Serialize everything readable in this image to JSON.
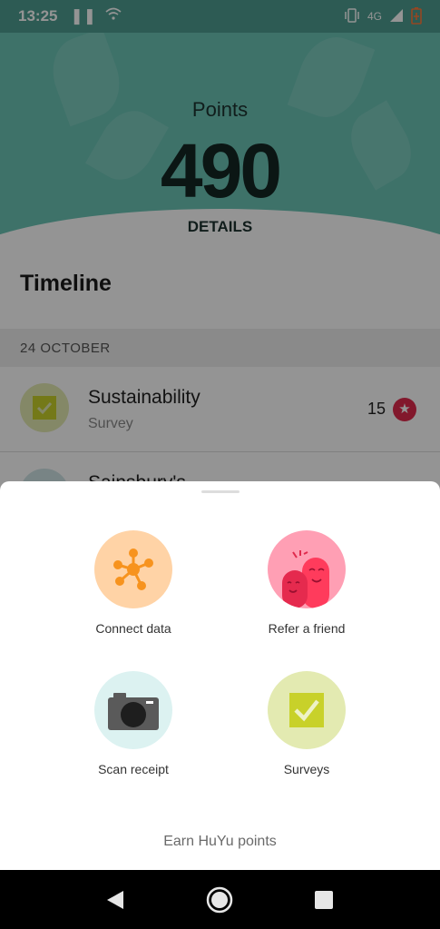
{
  "status_bar": {
    "time": "13:25",
    "network": "4G"
  },
  "hero": {
    "points_label": "Points",
    "points_value": "490",
    "details_label": "DETAILS"
  },
  "timeline": {
    "title": "Timeline",
    "date_header": "24 OCTOBER",
    "items": [
      {
        "title": "Sustainability",
        "subtitle": "Survey",
        "points": "15"
      },
      {
        "title": "Sainsbury's",
        "subtitle": "",
        "points": ""
      }
    ]
  },
  "sheet": {
    "actions": [
      {
        "label": "Connect data",
        "icon": "network-nodes-icon",
        "color": "#ffd3a6"
      },
      {
        "label": "Refer a friend",
        "icon": "friends-icon",
        "color": "#ff9fb4"
      },
      {
        "label": "Scan receipt",
        "icon": "camera-icon",
        "color": "#dcf2f1"
      },
      {
        "label": "Surveys",
        "icon": "checkbox-icon",
        "color": "#e3eab1"
      }
    ],
    "footer": "Earn HuYu points"
  },
  "colors": {
    "accent_teal": "#6cc4b6",
    "star_red": "#e02a4d",
    "orange_icon": "#f7931e",
    "survey_green": "#c8d12a"
  }
}
